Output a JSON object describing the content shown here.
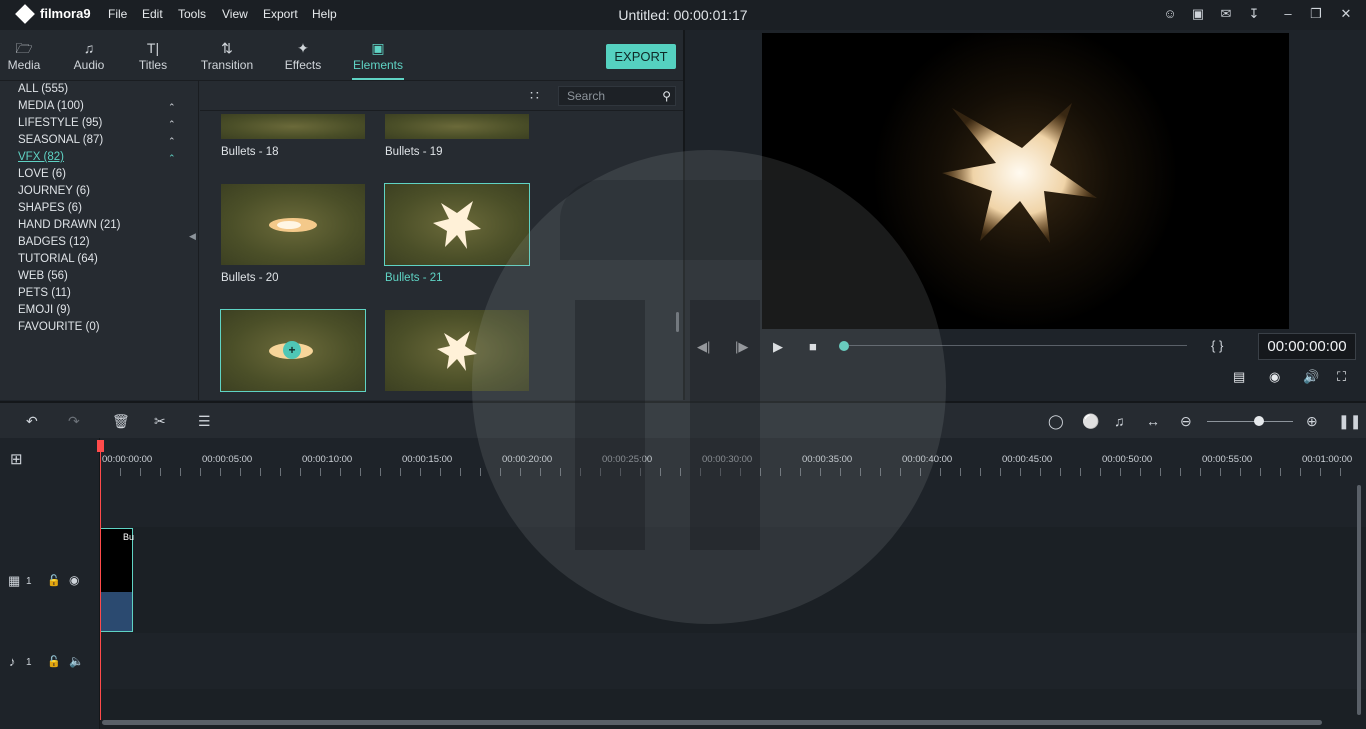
{
  "app": {
    "name": "filmora9"
  },
  "menu": [
    "File",
    "Edit",
    "Tools",
    "View",
    "Export",
    "Help"
  ],
  "title": "Untitled:  00:00:01:17",
  "tabs": [
    {
      "label": "Media",
      "icon": "folder-icon"
    },
    {
      "label": "Audio",
      "icon": "music-note-icon"
    },
    {
      "label": "Titles",
      "icon": "text-icon"
    },
    {
      "label": "Transition",
      "icon": "transition-icon"
    },
    {
      "label": "Effects",
      "icon": "effects-icon"
    },
    {
      "label": "Elements",
      "icon": "image-icon",
      "active": true
    }
  ],
  "export_label": "EXPORT",
  "categories": [
    {
      "label": "ALL (555)"
    },
    {
      "label": "MEDIA (100)",
      "expand": true
    },
    {
      "label": "LIFESTYLE (95)",
      "expand": true
    },
    {
      "label": "SEASONAL (87)",
      "expand": true
    },
    {
      "label": "VFX (82)",
      "expand": true,
      "active": true
    },
    {
      "label": "LOVE (6)"
    },
    {
      "label": "JOURNEY (6)"
    },
    {
      "label": "SHAPES (6)"
    },
    {
      "label": "HAND DRAWN (21)"
    },
    {
      "label": "BADGES (12)"
    },
    {
      "label": "TUTORIAL (64)"
    },
    {
      "label": "WEB (56)"
    },
    {
      "label": "PETS (11)"
    },
    {
      "label": "EMOJI (9)"
    },
    {
      "label": "FAVOURITE (0)"
    }
  ],
  "search": {
    "placeholder": "Search"
  },
  "thumbs": [
    {
      "label": "Bullets - 18"
    },
    {
      "label": "Bullets - 19"
    },
    {
      "label": "Bullets - 20"
    },
    {
      "label": "Bullets - 21",
      "selected": true
    }
  ],
  "preview": {
    "timecode": "00:00:00:00",
    "brackets": "{   }"
  },
  "ruler": [
    "00:00:00:00",
    "00:00:05:00",
    "00:00:10:00",
    "00:00:15:00",
    "00:00:20:00",
    "00:00:25:00",
    "00:00:30:00",
    "00:00:35:00",
    "00:00:40:00",
    "00:00:45:00",
    "00:00:50:00",
    "00:00:55:00",
    "00:01:00:00"
  ],
  "tracks": {
    "video_num": "1",
    "audio_num": "1",
    "clip_label": "Bu"
  },
  "colors": {
    "accent": "#5fd3c4",
    "playhead": "#ff4b4b"
  }
}
